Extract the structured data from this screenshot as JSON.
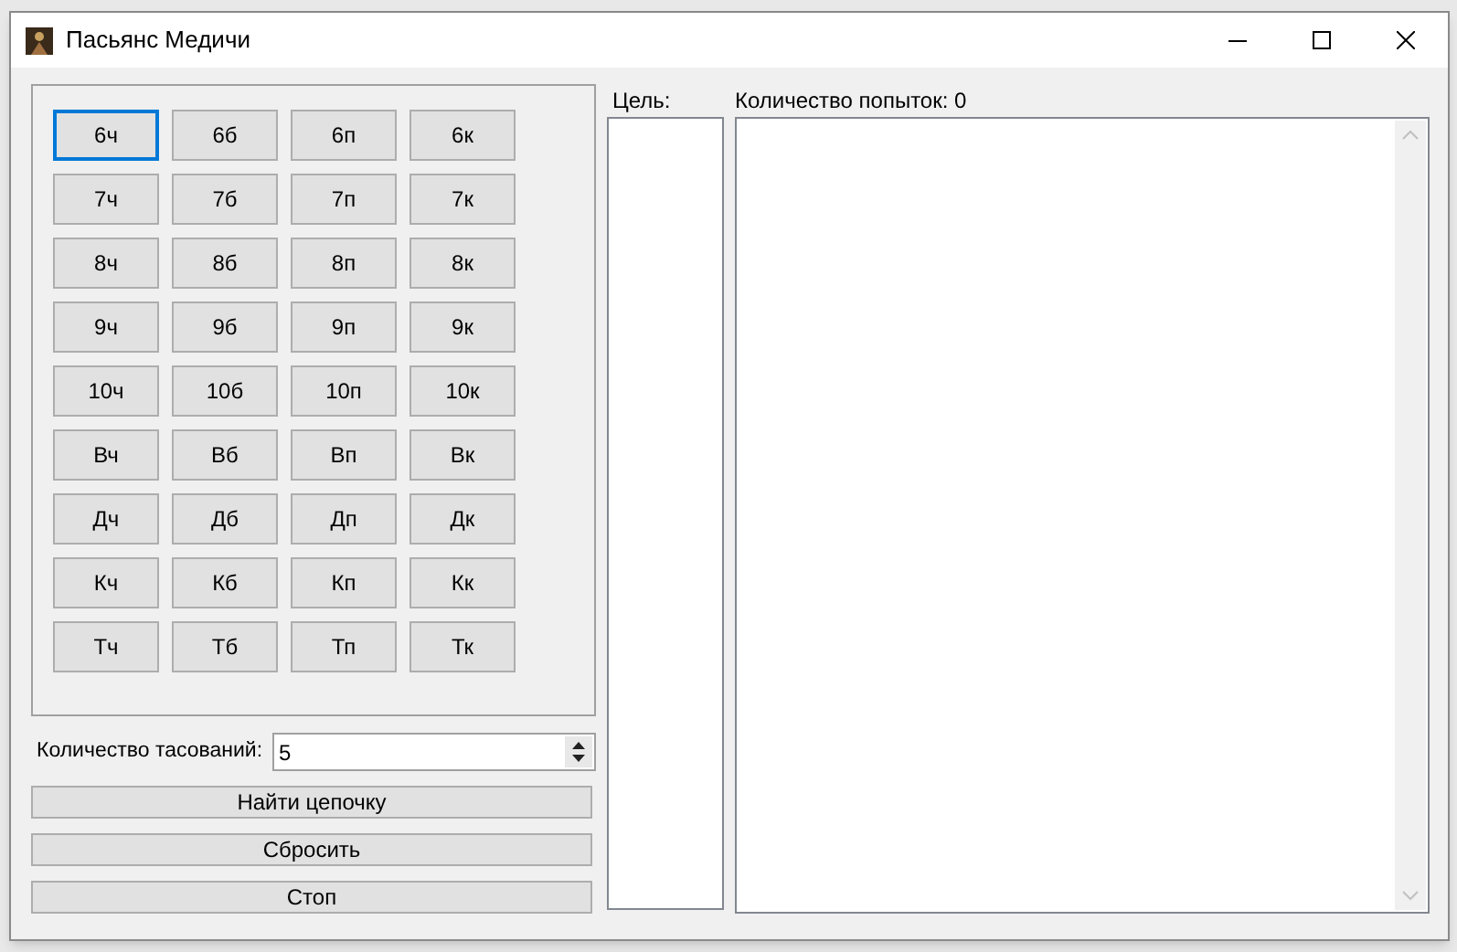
{
  "window": {
    "title": "Пасьянс Медичи"
  },
  "cards": [
    [
      {
        "label": "6ч",
        "focused": true
      },
      {
        "label": "6б",
        "focused": false
      },
      {
        "label": "6п",
        "focused": false
      },
      {
        "label": "6к",
        "focused": false
      }
    ],
    [
      {
        "label": "7ч",
        "focused": false
      },
      {
        "label": "7б",
        "focused": false
      },
      {
        "label": "7п",
        "focused": false
      },
      {
        "label": "7к",
        "focused": false
      }
    ],
    [
      {
        "label": "8ч",
        "focused": false
      },
      {
        "label": "8б",
        "focused": false
      },
      {
        "label": "8п",
        "focused": false
      },
      {
        "label": "8к",
        "focused": false
      }
    ],
    [
      {
        "label": "9ч",
        "focused": false
      },
      {
        "label": "9б",
        "focused": false
      },
      {
        "label": "9п",
        "focused": false
      },
      {
        "label": "9к",
        "focused": false
      }
    ],
    [
      {
        "label": "10ч",
        "focused": false
      },
      {
        "label": "10б",
        "focused": false
      },
      {
        "label": "10п",
        "focused": false
      },
      {
        "label": "10к",
        "focused": false
      }
    ],
    [
      {
        "label": "Вч",
        "focused": false
      },
      {
        "label": "Вб",
        "focused": false
      },
      {
        "label": "Вп",
        "focused": false
      },
      {
        "label": "Вк",
        "focused": false
      }
    ],
    [
      {
        "label": "Дч",
        "focused": false
      },
      {
        "label": "Дб",
        "focused": false
      },
      {
        "label": "Дп",
        "focused": false
      },
      {
        "label": "Дк",
        "focused": false
      }
    ],
    [
      {
        "label": "Кч",
        "focused": false
      },
      {
        "label": "Кб",
        "focused": false
      },
      {
        "label": "Кп",
        "focused": false
      },
      {
        "label": "Кк",
        "focused": false
      }
    ],
    [
      {
        "label": "Тч",
        "focused": false
      },
      {
        "label": "Тб",
        "focused": false
      },
      {
        "label": "Тп",
        "focused": false
      },
      {
        "label": "Тк",
        "focused": false
      }
    ]
  ],
  "shuffles": {
    "label": "Количество тасований:",
    "value": "5"
  },
  "buttons": [
    "Найти цепочку",
    "Сбросить",
    "Стоп"
  ],
  "target": {
    "label": "Цель:"
  },
  "log": {
    "label": "Количество попыток: 0"
  }
}
